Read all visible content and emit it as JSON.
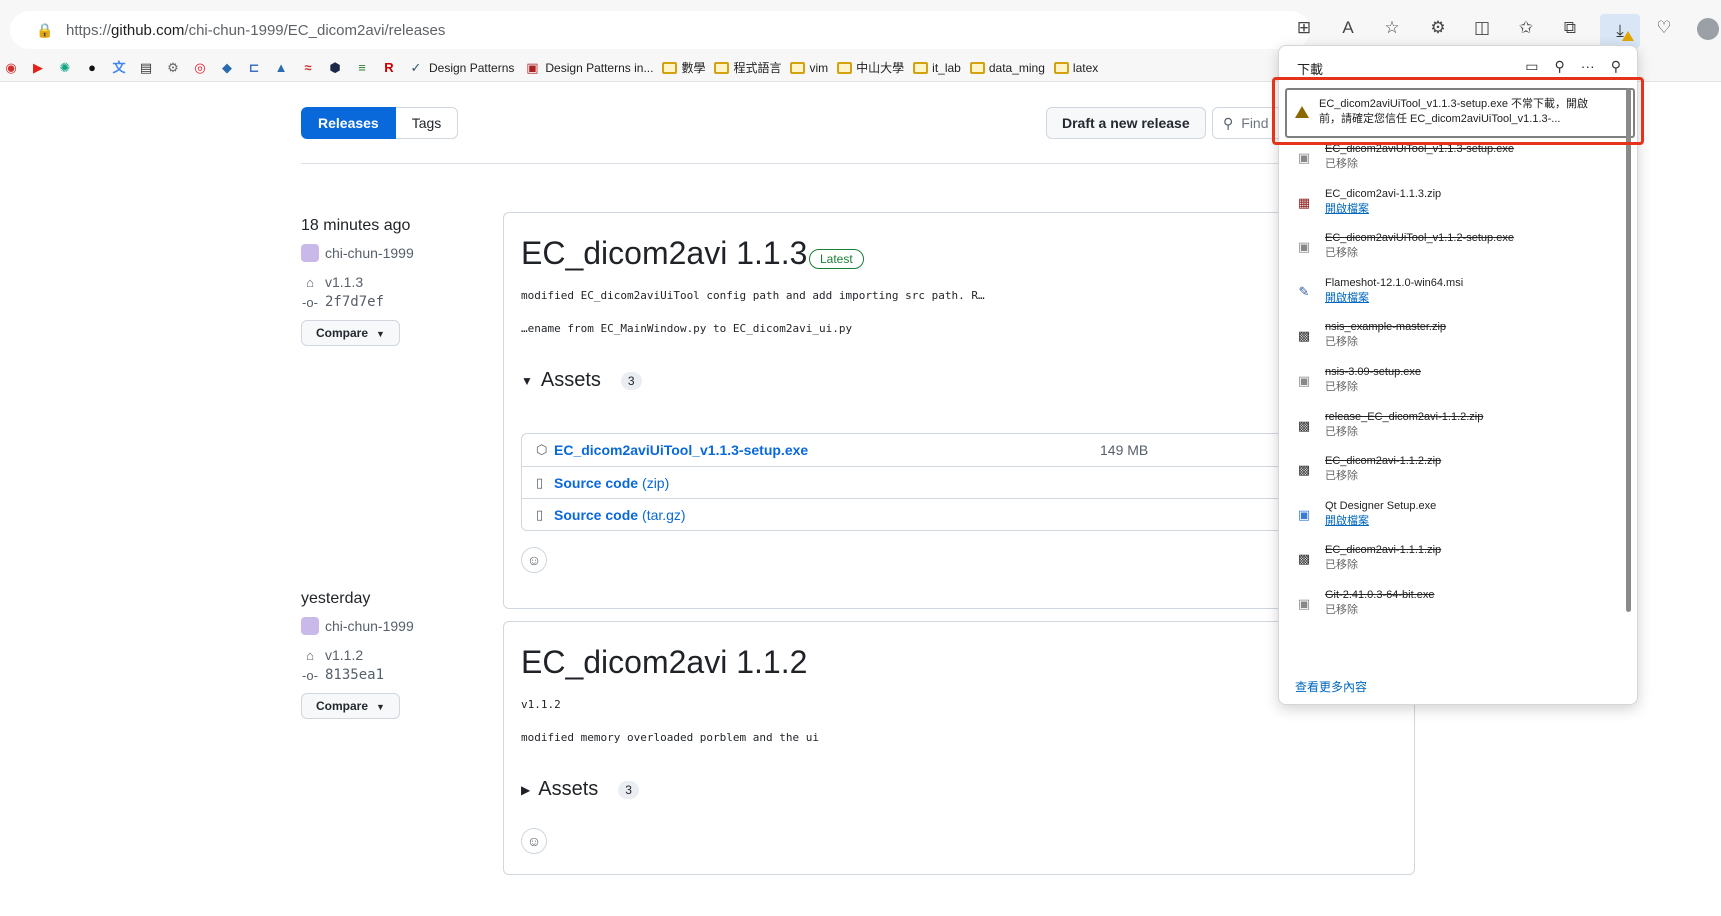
{
  "browser": {
    "url_prefix": "https://",
    "url_host": "github.com",
    "url_path": "/chi-chun-1999/EC_dicom2avi/releases",
    "bookmarks": [
      {
        "icon": "vivaldi-icon",
        "label": ""
      },
      {
        "icon": "youtube-icon",
        "label": ""
      },
      {
        "icon": "chatgpt-icon",
        "label": ""
      },
      {
        "icon": "github-icon",
        "label": ""
      },
      {
        "icon": "translate-icon",
        "label": ""
      },
      {
        "icon": "doc-icon",
        "label": ""
      },
      {
        "icon": "gear-icon",
        "label": ""
      },
      {
        "icon": "weibo-icon",
        "label": ""
      },
      {
        "icon": "layers-icon",
        "label": ""
      },
      {
        "icon": "bracket-icon",
        "label": ""
      },
      {
        "icon": "cap-icon",
        "label": ""
      },
      {
        "icon": "wave-icon",
        "label": ""
      },
      {
        "icon": "hex-icon",
        "label": ""
      },
      {
        "icon": "books-icon",
        "label": ""
      },
      {
        "icon": "r-icon",
        "label": ""
      },
      {
        "icon": "dp-icon",
        "label": "Design Patterns"
      },
      {
        "icon": "dp2-icon",
        "label": "Design Patterns in..."
      },
      {
        "icon": "folder-icon",
        "label": "數學"
      },
      {
        "icon": "folder-icon",
        "label": "程式語言"
      },
      {
        "icon": "folder-icon",
        "label": "vim"
      },
      {
        "icon": "folder-icon",
        "label": "中山大學"
      },
      {
        "icon": "folder-icon",
        "label": "it_lab"
      },
      {
        "icon": "folder-icon",
        "label": "data_ming"
      },
      {
        "icon": "folder-icon",
        "label": "latex"
      }
    ]
  },
  "github": {
    "tab_releases": "Releases",
    "tab_tags": "Tags",
    "draft_button": "Draft a new release",
    "find_placeholder": "Find",
    "releases": [
      {
        "when": "18 minutes ago",
        "author": "chi-chun-1999",
        "tag": "v1.1.3",
        "commit": "2f7d7ef",
        "compare": "Compare",
        "title": "EC_dicom2avi 1.1.3",
        "badge": "Latest",
        "desc1": "modified EC_dicom2aviUiTool config path and add importing src path. R…",
        "desc2": "…ename from EC_MainWindow.py to EC_dicom2avi_ui.py",
        "assets_label": "Assets",
        "assets_count": "3",
        "assets": [
          {
            "name": "EC_dicom2aviUiTool_v1.1.3-setup.exe",
            "size": "149 MB"
          },
          {
            "name": "Source code",
            "suffix": "(zip)"
          },
          {
            "name": "Source code",
            "suffix": "(tar.gz)"
          }
        ]
      },
      {
        "when": "yesterday",
        "author": "chi-chun-1999",
        "tag": "v1.1.2",
        "commit": "8135ea1",
        "compare": "Compare",
        "title": "EC_dicom2avi 1.1.2",
        "desc1": "v1.1.2",
        "desc2": "modified memory overloaded porblem and the ui",
        "assets_label": "Assets",
        "assets_count": "3"
      }
    ]
  },
  "downloads": {
    "title": "下載",
    "first_line1": "EC_dicom2aviUiTool_v1.1.3-setup.exe 不常下載，開啟",
    "first_line2": "前，請確定您信任 EC_dicom2aviUiTool_v1.1.3-...",
    "items": [
      {
        "name": "EC_dicom2aviUiTool_v1.1.3-setup.exe",
        "status": "已移除",
        "removed": true,
        "icon": "exe-icon"
      },
      {
        "name": "EC_dicom2avi-1.1.3.zip",
        "status": "開啟檔案",
        "removed": false,
        "icon": "winrar-icon"
      },
      {
        "name": "EC_dicom2aviUiTool_v1.1.2-setup.exe",
        "status": "已移除",
        "removed": true,
        "icon": "exe-icon"
      },
      {
        "name": "Flameshot-12.1.0-win64.msi",
        "status": "開啟檔案",
        "removed": false,
        "icon": "msi-icon"
      },
      {
        "name": "nsis_example-master.zip",
        "status": "已移除",
        "removed": true,
        "icon": "zip-icon"
      },
      {
        "name": "nsis-3.09-setup.exe",
        "status": "已移除",
        "removed": true,
        "icon": "exe-icon"
      },
      {
        "name": "release_EC_dicom2avi-1.1.2.zip",
        "status": "已移除",
        "removed": true,
        "icon": "zip-icon"
      },
      {
        "name": "EC_dicom2avi-1.1.2.zip",
        "status": "已移除",
        "removed": true,
        "icon": "zip-icon"
      },
      {
        "name": "Qt Designer Setup.exe",
        "status": "開啟檔案",
        "removed": false,
        "icon": "qt-icon"
      },
      {
        "name": "EC_dicom2avi-1.1.1.zip",
        "status": "已移除",
        "removed": true,
        "icon": "zip-icon"
      },
      {
        "name": "Git-2.41.0.3-64-bit.exe",
        "status": "已移除",
        "removed": true,
        "icon": "exe-icon"
      }
    ],
    "more": "查看更多內容"
  }
}
